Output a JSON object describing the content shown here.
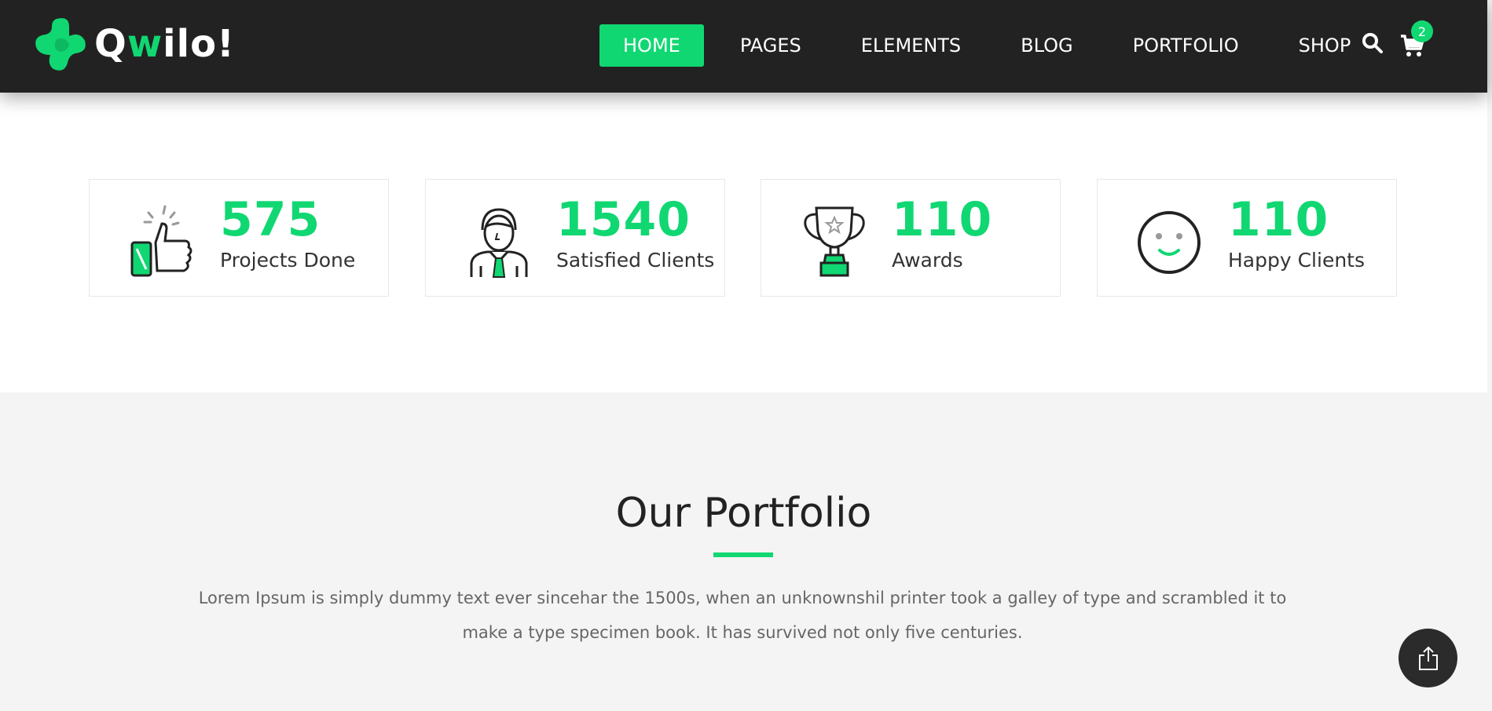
{
  "brand": {
    "logo_text_q": "Q",
    "logo_text_w": "w",
    "logo_text_rest": "ilo!",
    "accent": "#10d772"
  },
  "nav": {
    "items": [
      {
        "label": "HOME",
        "active": true
      },
      {
        "label": "PAGES"
      },
      {
        "label": "ELEMENTS"
      },
      {
        "label": "BLOG"
      },
      {
        "label": "PORTFOLIO"
      },
      {
        "label": "SHOP"
      }
    ],
    "icons": [
      "search-icon",
      "cart-icon"
    ],
    "cart_count": "2"
  },
  "stats": [
    {
      "icon": "thumbs-up-icon",
      "number": "575",
      "label": "Projects Done"
    },
    {
      "icon": "client-person-icon",
      "number": "1540",
      "label": "Satisfied Clients"
    },
    {
      "icon": "trophy-icon",
      "number": "110",
      "label": "Awards"
    },
    {
      "icon": "smiley-face-icon",
      "number": "110",
      "label": "Happy Clients"
    }
  ],
  "portfolio": {
    "title": "Our Portfolio",
    "description": "Lorem Ipsum is simply dummy text ever sincehar the 1500s, when an unknownshil printer took a galley of type and scrambled it to make a type specimen book. It has survived not only five centuries."
  },
  "share_button": {
    "icon": "share-icon"
  }
}
